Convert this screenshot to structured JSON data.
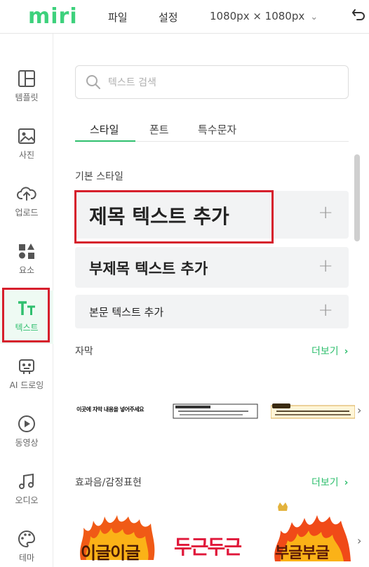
{
  "header": {
    "logo": "miri",
    "menu": [
      "파일",
      "설정"
    ],
    "canvas_size": "1080px × 1080px"
  },
  "sidebar": {
    "items": [
      {
        "label": "템플릿",
        "icon": "layout-icon"
      },
      {
        "label": "사진",
        "icon": "image-icon"
      },
      {
        "label": "업로드",
        "icon": "upload-cloud-icon"
      },
      {
        "label": "요소",
        "icon": "shapes-icon"
      },
      {
        "label": "텍스트",
        "icon": "text-tt-icon",
        "active": true
      },
      {
        "label": "AI 드로잉",
        "icon": "ai-robot-icon"
      },
      {
        "label": "동영상",
        "icon": "play-icon"
      },
      {
        "label": "오디오",
        "icon": "music-note-icon"
      },
      {
        "label": "테마",
        "icon": "palette-icon"
      }
    ]
  },
  "search": {
    "placeholder": "텍스트 검색",
    "value": ""
  },
  "tabs": [
    "스타일",
    "폰트",
    "특수문자"
  ],
  "basic_styles": {
    "label": "기본 스타일",
    "items": [
      "제목 텍스트 추가",
      "부제목 텍스트 추가",
      "본문 텍스트 추가"
    ]
  },
  "captions": {
    "label": "자막",
    "more": "더보기",
    "samples": [
      "이곳에 자막 내용을 넣어주세요"
    ]
  },
  "sound_effects": {
    "label": "효과음/감정표현",
    "more": "더보기",
    "samples": [
      "이글이글",
      "두근두근",
      "부글부글"
    ]
  },
  "colors": {
    "accent": "#2fbf6e",
    "highlight": "#d61f2c"
  }
}
